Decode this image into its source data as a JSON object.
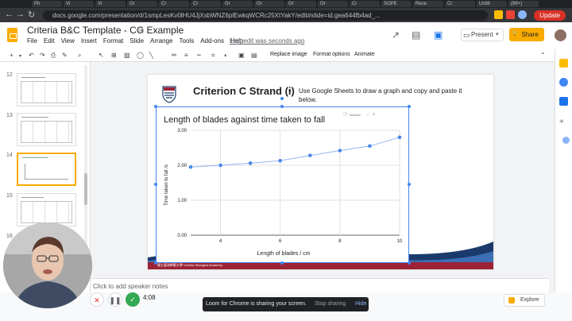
{
  "browser": {
    "tabs": [
      "Ph",
      "Vi",
      "Vi",
      "Gr",
      "Cr",
      "Cr",
      "Gr",
      "Gr",
      "Gr",
      "Gr",
      "Ci",
      "SOPE",
      "Rece",
      "Cr",
      "Untitl",
      "(99+)"
    ],
    "url": "docs.google.com/presentation/d/1smpLesKv0lHU4JjXsbWNZ6plEwkqWCRc25XtYakY/edit#slide=id.gea644fb4ad_...",
    "update_label": "Update"
  },
  "doc": {
    "title": "Criteria B&C Template - CG Example",
    "menu": [
      "File",
      "Edit",
      "View",
      "Insert",
      "Format",
      "Slide",
      "Arrange",
      "Tools",
      "Add-ons",
      "Help"
    ],
    "last_edit": "Last edit was seconds ago",
    "present_label": "Present",
    "share_label": "Share"
  },
  "toolbar": {
    "replace_image": "Replace image",
    "format_options": "Format options",
    "animate": "Animate"
  },
  "filmstrip": {
    "slide_numbers": [
      "12",
      "13",
      "14",
      "15",
      "16"
    ]
  },
  "slide": {
    "title": "Criterion C Strand (i)",
    "dash": "-",
    "subtitle": "Use Google Sheets to draw a graph and copy and paste it below.",
    "footer": "國立臺灣師範大學 Victoria Shanghai Academy"
  },
  "chart_data": {
    "type": "scatter",
    "title": "Length of blades against time taken to fall",
    "xlabel": "Length of blades / cm",
    "ylabel": "Time taken to fall /s",
    "xlim": [
      3,
      10
    ],
    "ylim": [
      0,
      3
    ],
    "x_ticks": [
      "4",
      "6",
      "8",
      "10"
    ],
    "y_ticks": [
      "0.00",
      "1.00",
      "2.00",
      "3.00"
    ],
    "grid": true,
    "series": [
      {
        "points": [
          [
            3,
            1.95
          ],
          [
            4,
            2.0
          ],
          [
            5,
            2.06
          ],
          [
            6,
            2.13
          ],
          [
            7,
            2.28
          ],
          [
            8,
            2.42
          ],
          [
            9,
            2.55
          ],
          [
            10,
            2.8
          ]
        ],
        "color": "#4a86e8"
      }
    ],
    "trendline": {
      "color": "#4a86e8"
    }
  },
  "notes": {
    "placeholder": "Click to add speaker notes"
  },
  "explore": {
    "label": "Explore"
  },
  "loom": {
    "message": "Loom for Chrome is sharing your screen.",
    "stop_label": "Stop sharing",
    "hide_label": "Hide"
  },
  "recorder": {
    "time": "4:08"
  },
  "colors": {
    "accent": "#f9ab00",
    "selection": "#4285f4",
    "brand_red": "#9b2335",
    "wave_blue": "#1a3a6b"
  }
}
